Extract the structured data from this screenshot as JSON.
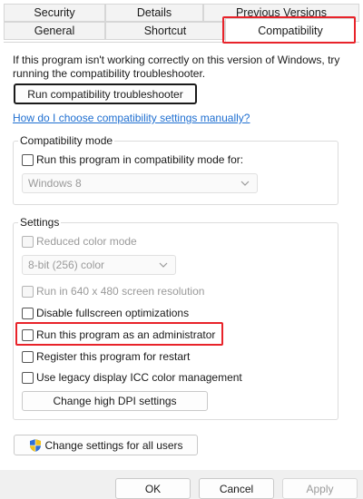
{
  "tabs": {
    "row1": [
      "Security",
      "Details",
      "Previous Versions"
    ],
    "row2": [
      "General",
      "Shortcut",
      "Compatibility"
    ]
  },
  "intro_text": "If this program isn't working correctly on this version of Windows, try running the compatibility troubleshooter.",
  "troubleshooter_button": "Run compatibility troubleshooter",
  "manual_link": "How do I choose compatibility settings manually?",
  "compat_mode": {
    "group_label": "Compatibility mode",
    "checkbox_label": "Run this program in compatibility mode for:",
    "selected_value": "Windows 8"
  },
  "settings": {
    "group_label": "Settings",
    "reduced_color": "Reduced color mode",
    "color_value": "8-bit (256) color",
    "resolution": "Run in 640 x 480 screen resolution",
    "disable_fullscreen": "Disable fullscreen optimizations",
    "run_as_admin": "Run this program as an administrator",
    "register_restart": "Register this program for restart",
    "legacy_icc": "Use legacy display ICC color management",
    "dpi_button": "Change high DPI settings"
  },
  "all_users_button": "Change settings for all users",
  "footer": {
    "ok": "OK",
    "cancel": "Cancel",
    "apply": "Apply"
  },
  "colors": {
    "highlight": "#e8232a",
    "link": "#1f6fd1",
    "disabled_text": "#9a9a9a"
  }
}
